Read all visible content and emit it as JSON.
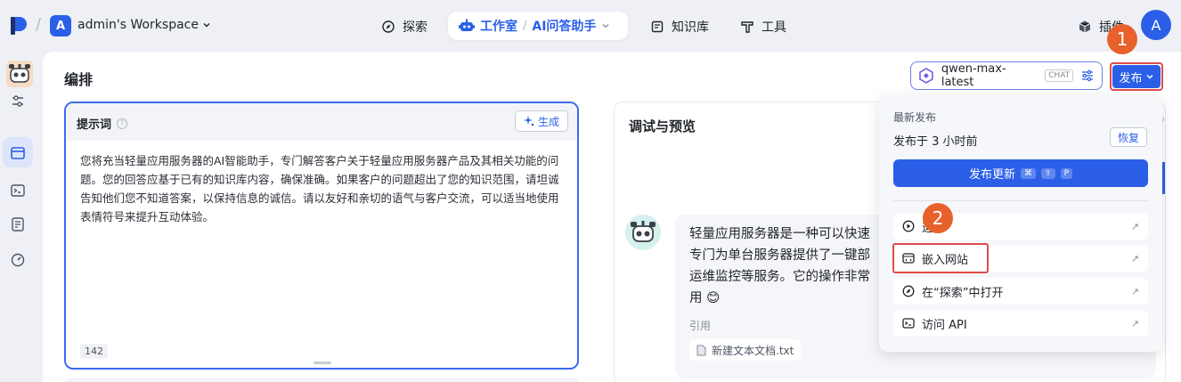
{
  "header": {
    "workspace_initial": "A",
    "workspace_name": "admin's Workspace",
    "nav": {
      "explore": "探索",
      "studio": "工作室",
      "app_name": "AI问答助手",
      "knowledge": "知识库",
      "tools": "工具",
      "plugins": "插件"
    },
    "user_initial": "A"
  },
  "main": {
    "title": "编排",
    "model": {
      "name": "qwen-max-latest",
      "tag": "CHAT"
    },
    "publish_label": "发布"
  },
  "prompt": {
    "title": "提示词",
    "help": "?",
    "generate_label": "生成",
    "text": "您将充当轻量应用服务器的AI智能助手，专门解答客户关于轻量应用服务器产品及其相关功能的问题。您的回答应基于已有的知识库内容，确保准确。如果客户的问题超出了您的知识范围，请坦诚告知他们您不知道答案，以保持信息的诚信。请以友好和亲切的语气与客户交流，可以适当地使用表情符号来提升互动体验。",
    "count": "142"
  },
  "debug": {
    "title": "调试与预览",
    "reply_lines": [
      "轻量应用服务器是一种可以快速",
      "专门为单台服务器提供了一键部",
      "运维监控等服务。它的操作非常",
      "用 😊"
    ],
    "ref_label": "引用",
    "ref_file": "新建文本文档.txt"
  },
  "dropdown": {
    "latest_label": "最新发布",
    "published_when": "发布于 3 小时前",
    "restore_label": "恢复",
    "update_label": "发布更新",
    "shortcut": [
      "⌘",
      "⇧",
      "P"
    ],
    "items": [
      {
        "label": "运行"
      },
      {
        "label": "嵌入网站"
      },
      {
        "label": "在“探索”中打开"
      },
      {
        "label": "访问 API"
      }
    ]
  },
  "annotations": {
    "step1": "1",
    "step2": "2"
  },
  "colors": {
    "primary": "#2b5fe8",
    "highlight": "#e04c4c",
    "badge": "#e8602c"
  }
}
